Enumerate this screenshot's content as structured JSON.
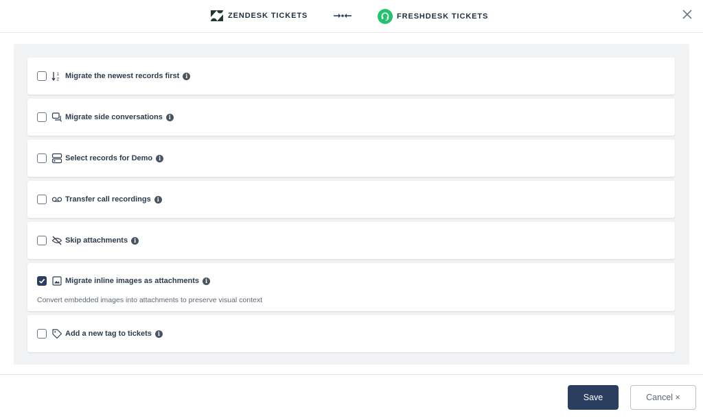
{
  "header": {
    "source_label": "ZENDESK TICKETS",
    "target_label": "FRESHDESK TICKETS",
    "source_logo_icon": "zendesk-logo-icon",
    "target_logo_icon": "freshdesk-headset-logo-icon",
    "sync_icon": "arrows-merge-icon",
    "close_icon": "close-icon"
  },
  "options": [
    {
      "label": "Migrate the newest records first",
      "icon": "sort-numeric-icon",
      "checked": false
    },
    {
      "label": "Migrate side conversations",
      "icon": "chat-bubbles-icon",
      "checked": false
    },
    {
      "label": "Select records for Demo",
      "icon": "records-select-icon",
      "checked": false
    },
    {
      "label": "Transfer call recordings",
      "icon": "voicemail-icon",
      "checked": false
    },
    {
      "label": "Skip attachments",
      "icon": "eye-off-icon",
      "checked": false
    },
    {
      "label": "Migrate inline images as attachments",
      "icon": "image-icon",
      "checked": true,
      "description": "Convert embedded images into attachments to preserve visual context"
    },
    {
      "label": "Add a new tag to tickets",
      "icon": "tag-icon",
      "checked": false
    }
  ],
  "footer": {
    "save_label": "Save",
    "cancel_label": "Cancel ×"
  },
  "colors": {
    "primary": "#2c3e5f",
    "freshdesk_green": "#25c16f",
    "panel_bg": "#f2f3f5"
  }
}
